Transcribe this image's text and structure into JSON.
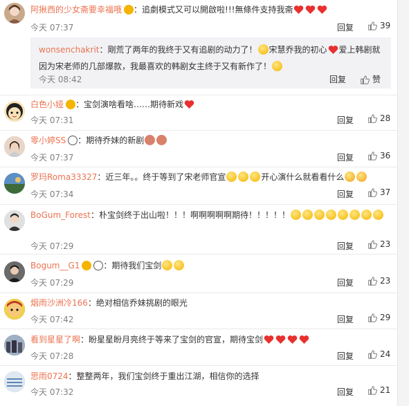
{
  "comments": [
    {
      "user": "阿揪西的少女斋要幸福哦",
      "text": "：追劇模式又可以開啟啦!!!無條件支持我斋",
      "time": "今天 07:37",
      "likes": "39",
      "avatar_color": "#c9a98a",
      "reply": {
        "user": "wonsenchakrit",
        "text1": "：剛荒了两年的我终于又有追剧的动力了！",
        "text2": "宋慧乔我的初心",
        "text3": "爱上韩剧就因为宋老师的几部爆款，我最喜欢的韩剧女主终于又有新作了！",
        "time": "今天 08:42",
        "likes": "赞"
      }
    },
    {
      "user": "白色小娅",
      "text": "：宝剑演啥看啥……期待新戏",
      "time": "今天 07:31",
      "likes": "28",
      "avatar_color": "#f2d8a0"
    },
    {
      "user": "零小婷SS",
      "text": "：期待乔妹的新剧",
      "time": "今天 07:37",
      "likes": "36",
      "avatar_color": "#d8b9a0"
    },
    {
      "user": "罗玛Roma33327",
      "text": "：近三年。。终于等到了宋老师官宣",
      "text_b": "开心演什么就看看什么",
      "time": "今天 07:34",
      "likes": "37",
      "avatar_color": "#4e7fb0"
    },
    {
      "user": "BoGum_Forest",
      "text": "：朴宝剑终于出山啦！！！啊啊啊啊啊期待！！！！！",
      "time": "今天 07:29",
      "likes": "23",
      "avatar_color": "#b5b5b5"
    },
    {
      "user": "Bogum__G1",
      "text": "：期待我们宝剑",
      "time": "今天 07:29",
      "likes": "23",
      "avatar_color": "#3b3b3b"
    },
    {
      "user": "烟雨沙洲冷166",
      "text": "：绝对相信乔妹挑剧的眼光",
      "time": "今天 07:42",
      "likes": "29",
      "avatar_color": "#c0392b"
    },
    {
      "user": "看到星星了啊",
      "text": "：盼星星盼月亮终于等来了宝剑的官宣，期待宝剑",
      "time": "今天 07:28",
      "likes": "24",
      "avatar_color": "#7a8aa0"
    },
    {
      "user": "思雨0724",
      "text": "：整整两年，我们宝剑终于重出江湖，相信你的选择",
      "time": "今天 07:32",
      "likes": "21",
      "avatar_color": "#5d86b5"
    }
  ],
  "labels": {
    "reply": "回复"
  },
  "colors": {
    "username": "#eb7350",
    "heart": "#e8302f"
  }
}
